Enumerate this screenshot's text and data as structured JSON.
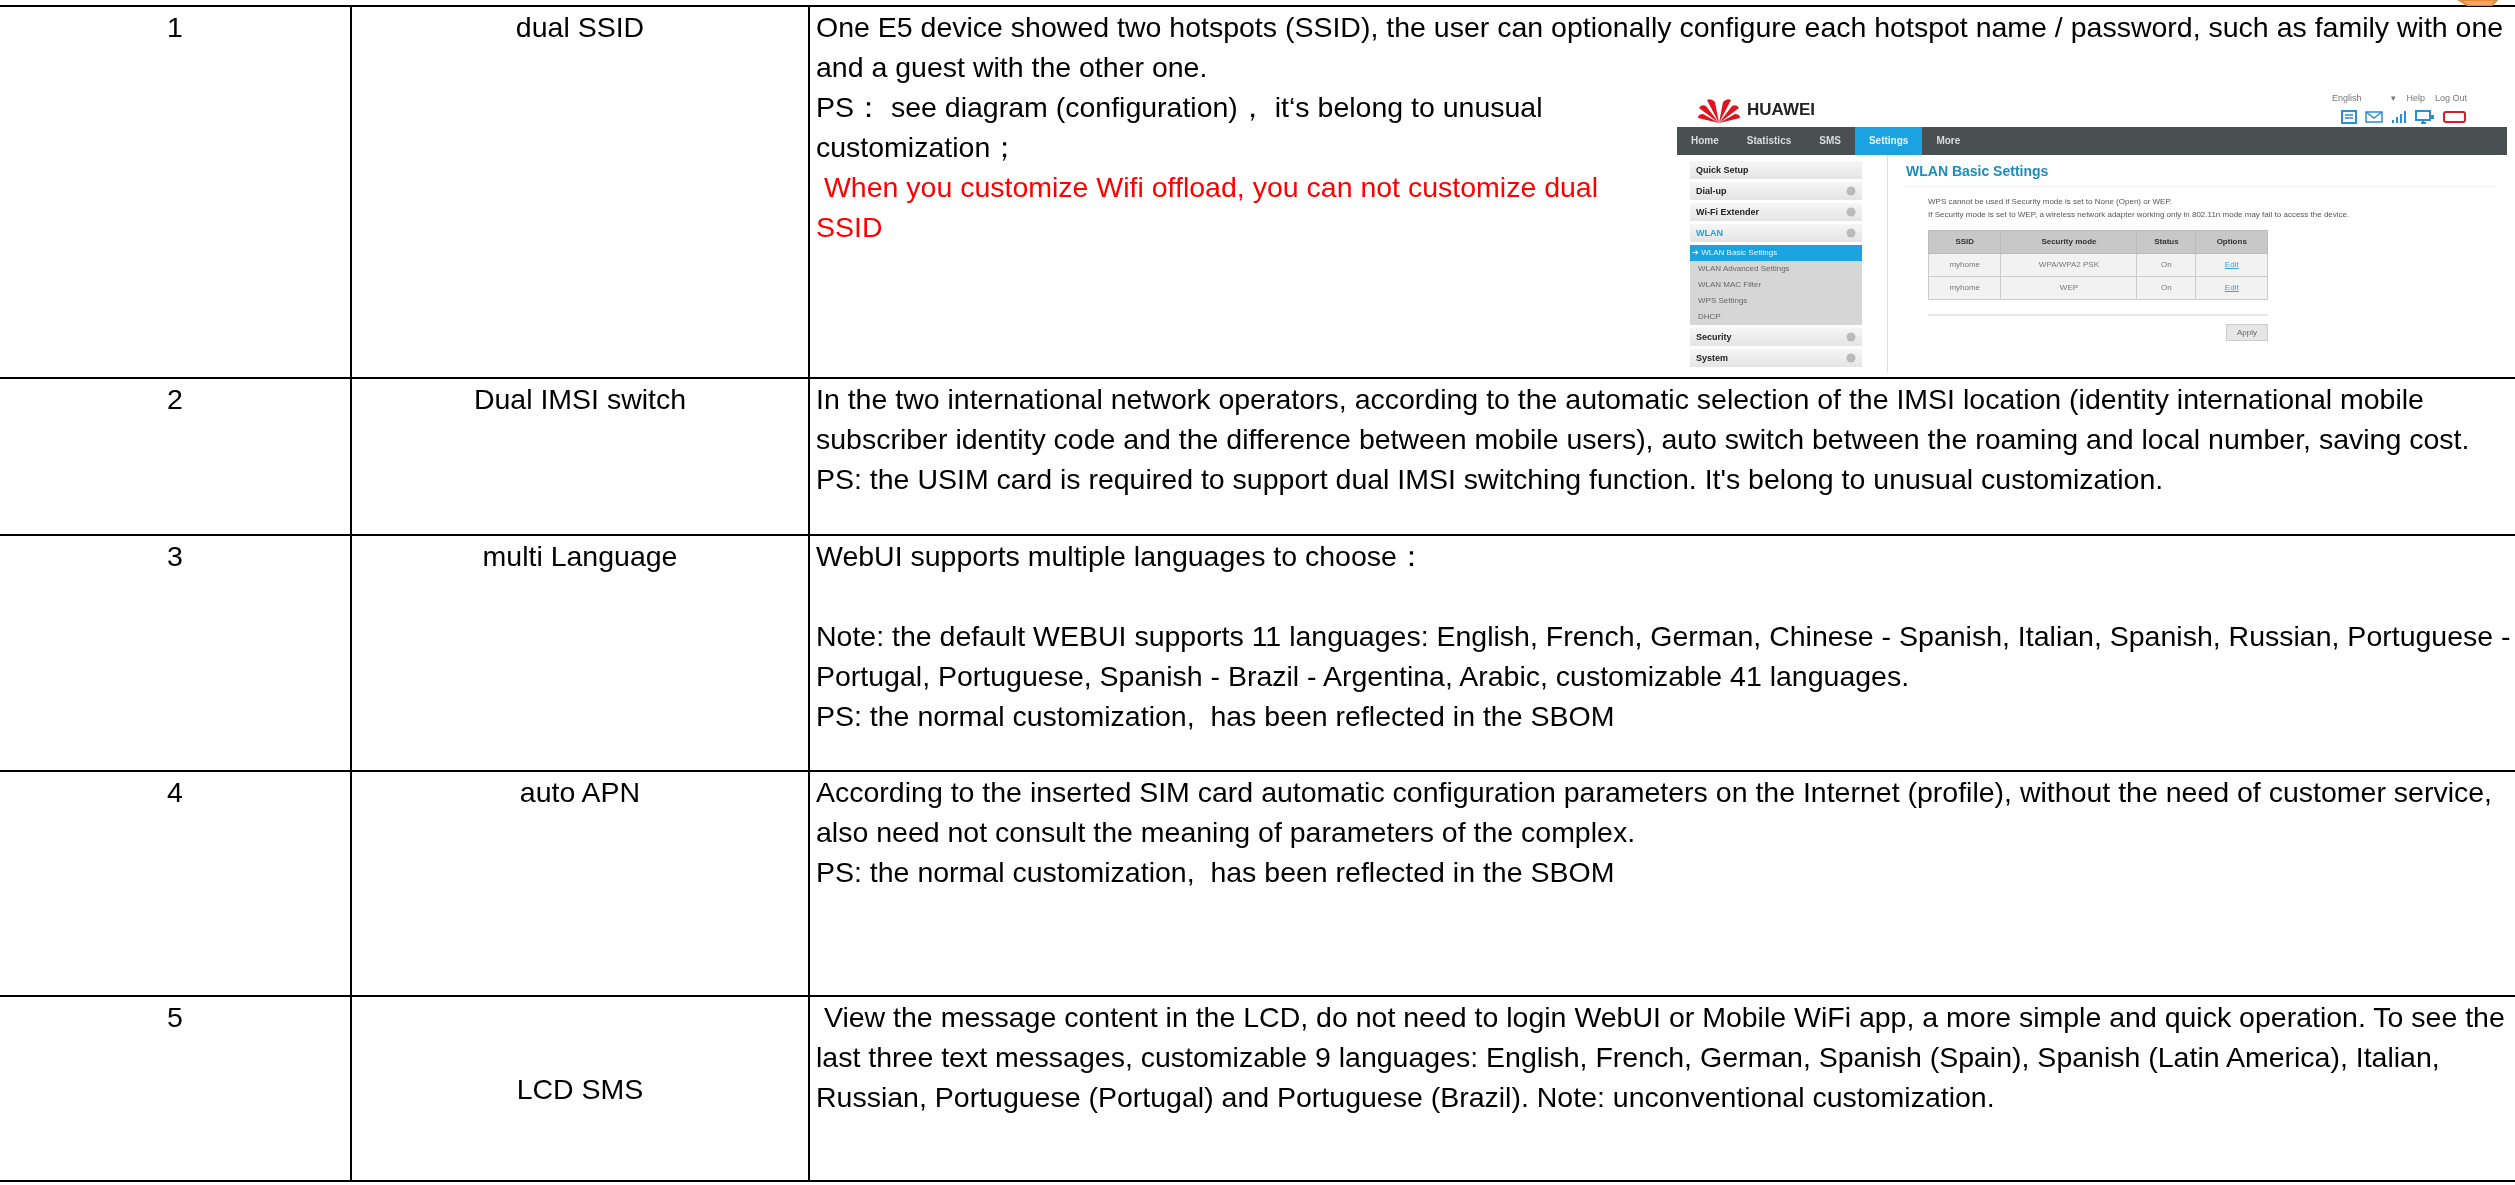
{
  "rows": [
    {
      "number": "1",
      "feature": "dual SSID",
      "blocks": [
        [
          {
            "kind": "text",
            "text": "One E5 device showed two hotspots (SSID), the user can optionally configure each hotspot name / password, such as family with one and a guest with the other one."
          },
          {
            "kind": "text",
            "text": "PS： see diagram (configuration)， it‘s belong to unusual customization；"
          },
          {
            "kind": "warning",
            "text": " When you customize Wifi offload, you can not customize dual SSID"
          }
        ]
      ],
      "screenshot": {
        "brand": "HUAWEI",
        "language": "English",
        "language_caret": "▾",
        "links": [
          "Help",
          "Log Out"
        ],
        "nav": [
          {
            "label": "Home",
            "selected": false
          },
          {
            "label": "Statistics",
            "selected": false
          },
          {
            "label": "SMS",
            "selected": false
          },
          {
            "label": "Settings",
            "selected": true
          },
          {
            "label": "More",
            "selected": false
          }
        ],
        "sidebar": [
          {
            "label": "Quick Setup",
            "toggle": false,
            "expanded": false
          },
          {
            "label": "Dial-up",
            "toggle": true,
            "expanded": false
          },
          {
            "label": "Wi-Fi Extender",
            "toggle": true,
            "expanded": false
          },
          {
            "label": "WLAN",
            "toggle": true,
            "expanded": true,
            "children": [
              {
                "label": "WLAN Basic Settings",
                "selected": true,
                "marker": "➔"
              },
              {
                "label": "WLAN Advanced Settings",
                "selected": false
              },
              {
                "label": "WLAN MAC Filter",
                "selected": false
              },
              {
                "label": "WPS Settings",
                "selected": false
              },
              {
                "label": "DHCP",
                "selected": false
              }
            ]
          },
          {
            "label": "Security",
            "toggle": true,
            "expanded": false
          },
          {
            "label": "System",
            "toggle": true,
            "expanded": false
          }
        ],
        "title": "WLAN Basic Settings",
        "notes": [
          "WPS cannot be used if Security mode is set to None (Open) or WEP.",
          "If Security mode is set to WEP, a wireless network adapter working only in 802.11n mode may fail to access the device."
        ],
        "table": {
          "columns": [
            "SSID",
            "Security mode",
            "Status",
            "Options"
          ],
          "rows": [
            [
              "myhome",
              "WPA/WPA2 PSK",
              "On",
              "Edit"
            ],
            [
              "myhome",
              "WEP",
              "On",
              "Edit"
            ]
          ]
        },
        "apply": "Apply"
      }
    },
    {
      "number": "2",
      "feature": "Dual IMSI switch",
      "blocks": [
        [
          {
            "kind": "text",
            "text": "In the two international network operators, according to the automatic selection of the IMSI location (identity international mobile subscriber identity code and the difference between mobile users), auto switch between the roaming and local number, saving cost."
          },
          {
            "kind": "text",
            "text": "PS: the USIM card is required to support dual IMSI switching function. It's belong to unusual customization."
          }
        ]
      ]
    },
    {
      "number": "3",
      "feature": "multi Language",
      "blocks": [
        [
          {
            "kind": "text",
            "text": "WebUI supports multiple languages to choose："
          }
        ],
        [
          {
            "kind": "text",
            "text": "Note: the default WEBUI supports 11 languages: English, French, German, Chinese - Spanish, Italian, Spanish, Russian, Portuguese - Portugal, Portuguese, Spanish - Brazil - Argentina, Arabic, customizable 41 languages."
          },
          {
            "kind": "text",
            "text": "PS: the normal customization,  has been reflected in the SBOM"
          }
        ]
      ]
    },
    {
      "number": "4",
      "feature": "auto APN",
      "blocks": [
        [
          {
            "kind": "text",
            "text": "According to the inserted SIM card automatic configuration parameters on the Internet (profile), without the need of customer service, also need not consult the meaning of parameters of the complex."
          },
          {
            "kind": "text",
            "text": "PS: the normal customization,  has been reflected in the SBOM"
          }
        ]
      ]
    },
    {
      "number": "5",
      "feature": "LCD SMS",
      "blocks": [
        [
          {
            "kind": "text",
            "text": " View the message content in the LCD, do not need to login WebUI or Mobile WiFi app, a more simple and quick operation. To see the last three text messages, customizable 9 languages: English, French, German, Spanish (Spain), Spanish (Latin America), Italian, Russian, Portuguese (Portugal) and Portuguese (Brazil). Note: unconventional customization."
          }
        ]
      ]
    }
  ]
}
